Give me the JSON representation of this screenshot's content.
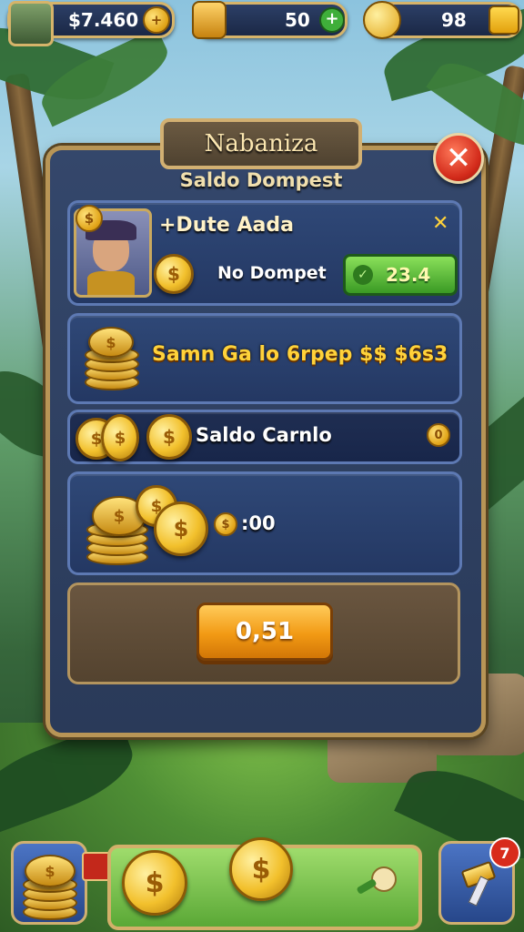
{
  "topbar": {
    "coins_value": "$7.460",
    "gems_value": "50",
    "gold_value": "98"
  },
  "dialog": {
    "title": "Nabaniza",
    "subtitle": "Saldo Dompest",
    "profile": {
      "name": "+Dute Aada",
      "balance_label": "No Dompet",
      "balance_value": "23.4"
    },
    "reward_row": {
      "text": "Samn Ga lo 6rpep $$ $6s3"
    },
    "balance_row": {
      "label": "Saldo Carnlo",
      "value": "0"
    },
    "coin_row": {
      "value": ":00"
    },
    "action_button": {
      "label": "0,51"
    }
  },
  "bottom": {
    "badge_count": "7"
  },
  "colors": {
    "accent_gold": "#ffd23a",
    "panel": "#2f4877",
    "button": "#f29a14",
    "close": "#d22a1a"
  },
  "icons": [
    "avatar",
    "coin-icon",
    "gem-icon",
    "gold-icon",
    "close-icon",
    "hammer-icon",
    "key-icon"
  ]
}
